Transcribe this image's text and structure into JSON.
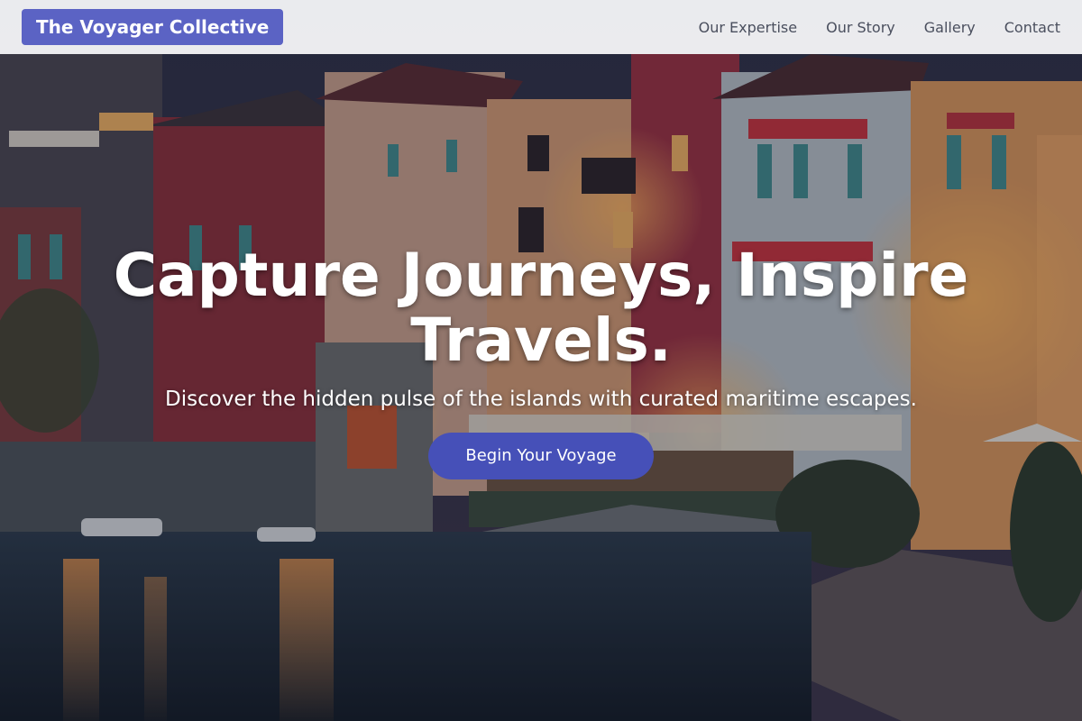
{
  "nav": {
    "brand": "The Voyager Collective",
    "links": [
      "Our Expertise",
      "Our Story",
      "Gallery",
      "Contact"
    ]
  },
  "hero": {
    "title": "Capture Journeys, Inspire Travels.",
    "subtitle": "Discover the hidden pulse of the islands with curated maritime escapes.",
    "cta_label": "Begin Your Voyage"
  },
  "colors": {
    "brand_bg": "#5b63c4",
    "cta_bg": "#4650b8",
    "nav_text": "#4a4f5e"
  }
}
